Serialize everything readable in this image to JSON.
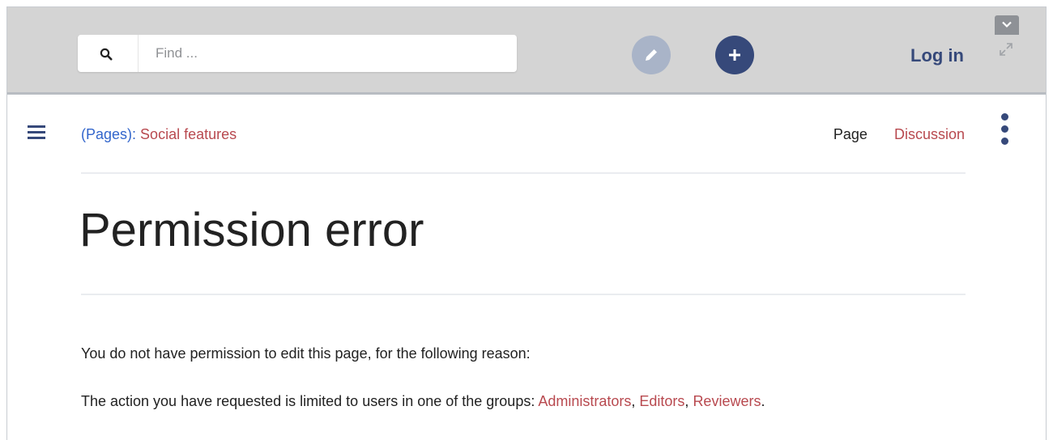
{
  "header": {
    "search": {
      "placeholder": "Find ...",
      "value": ""
    },
    "login_label": "Log in"
  },
  "breadcrumb": {
    "namespace": "(Pages):",
    "page": "Social features"
  },
  "tabs": {
    "page": "Page",
    "discussion": "Discussion"
  },
  "content": {
    "title": "Permission error",
    "reason_intro": "You do not have permission to edit this page, for the following reason:",
    "groups_sentence": "The action you have requested is limited to users in one of the groups: ",
    "groups": [
      "Administrators",
      "Editors",
      "Reviewers"
    ],
    "separator": ", ",
    "end_punct": "."
  },
  "colors": {
    "accent": "#36497a",
    "link_red": "#b8494f",
    "link_blue": "#3366cc",
    "header_bg": "#d4d4d4"
  },
  "icons": [
    "search-icon",
    "pencil-icon",
    "plus-icon",
    "chevron-down-icon",
    "expand-icon",
    "hamburger-menu-icon",
    "more-vertical-icon"
  ]
}
